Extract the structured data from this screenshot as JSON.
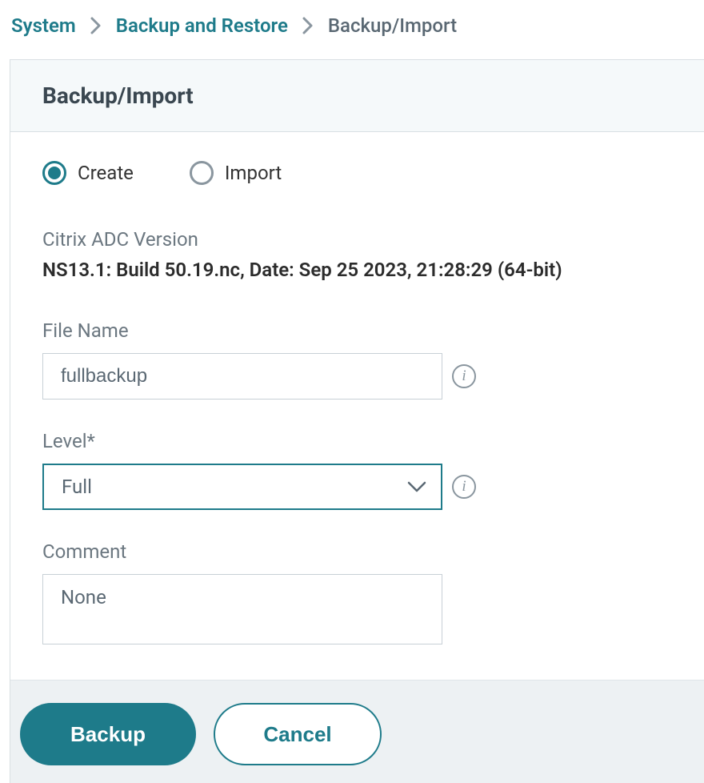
{
  "breadcrumb": {
    "items": [
      {
        "label": "System",
        "type": "link"
      },
      {
        "label": "Backup and Restore",
        "type": "link"
      },
      {
        "label": "Backup/Import",
        "type": "current"
      }
    ]
  },
  "panel": {
    "title": "Backup/Import"
  },
  "radios": {
    "create": "Create",
    "import": "Import",
    "selected": "create"
  },
  "version": {
    "label": "Citrix ADC Version",
    "value": "NS13.1: Build 50.19.nc, Date: Sep 25 2023, 21:28:29   (64-bit)"
  },
  "form": {
    "fileName": {
      "label": "File Name",
      "value": "fullbackup"
    },
    "level": {
      "label": "Level*",
      "value": "Full"
    },
    "comment": {
      "label": "Comment",
      "value": "None"
    }
  },
  "buttons": {
    "backup": "Backup",
    "cancel": "Cancel"
  }
}
